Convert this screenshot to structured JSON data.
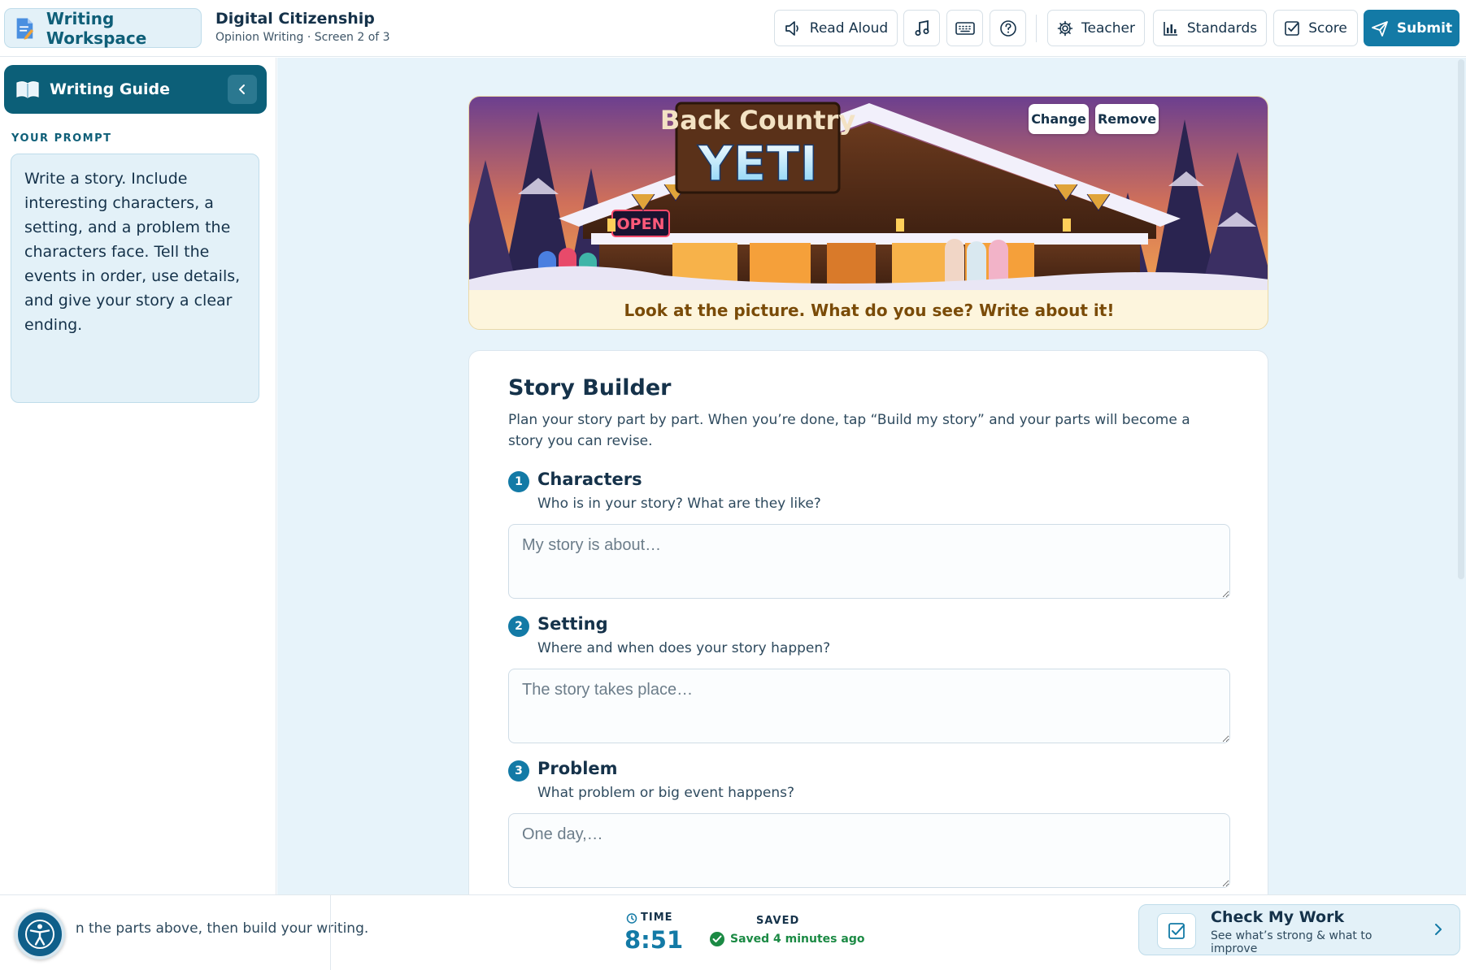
{
  "topbar": {
    "app_name": "Writing Workspace",
    "doc_title": "Digital Citizenship",
    "doc_subtitle": "Opinion Writing · Screen 2 of 3",
    "read_aloud_label": "Read Aloud",
    "teacher_label": "Teacher",
    "standards_label": "Standards",
    "score_label": "Score",
    "submit_label": "Submit"
  },
  "sidebar": {
    "guide_title": "Writing Guide",
    "prompt_label": "YOUR PROMPT",
    "prompt_text": "Write a story. Include interesting characters, a setting, and a problem the characters face. Tell the events in order, use details, and give your story a clear ending."
  },
  "banner": {
    "sign_line1": "Back Country",
    "sign_line2": "YETI",
    "open_sign": "OPEN",
    "change_label": "Change",
    "remove_label": "Remove",
    "caption": "Look at the picture. What do you see? Write about it!"
  },
  "builder": {
    "title": "Story Builder",
    "description": "Plan your story part by part. When you’re done, tap “Build my story” and your parts will become a story you can revise.",
    "steps": [
      {
        "number": "1",
        "title": "Characters",
        "hint": "Who is in your story? What are they like?",
        "placeholder": "My story is about…",
        "value": ""
      },
      {
        "number": "2",
        "title": "Setting",
        "hint": "Where and when does your story happen?",
        "placeholder": "The story takes place…",
        "value": ""
      },
      {
        "number": "3",
        "title": "Problem",
        "hint": "What problem or big event happens?",
        "placeholder": "One day,…",
        "value": ""
      }
    ]
  },
  "bottombar": {
    "hint": "Fill in the parts above, then build your writing.",
    "time_label": "TIME",
    "time_value": "8:51",
    "saved_label": "SAVED",
    "saved_value": "Saved 4 minutes ago",
    "check_title": "Check My Work",
    "check_subtitle": "See what’s strong & what to improve"
  },
  "colors": {
    "primary": "#137aa6",
    "guide_header": "#0c5f78",
    "main_bg": "#e7f3fa",
    "caption_bg": "#fdf5dd",
    "caption_text": "#7a4b08",
    "saved_green": "#1b8a44"
  },
  "icons": {
    "brand": "document-pencil-icon",
    "read_aloud": "speaker-icon",
    "music": "music-note-icon",
    "keyboard": "keyboard-icon",
    "help": "question-circle-icon",
    "teacher": "gear-icon",
    "standards": "bar-chart-icon",
    "score": "checkbox-icon",
    "submit": "paper-plane-icon",
    "guide": "open-book-icon",
    "collapse": "chevron-left-icon",
    "accessibility": "accessibility-person-icon",
    "timer": "stopwatch-icon",
    "saved": "check-circle-icon",
    "check_work": "checkbox-icon",
    "check_arrow": "chevron-right-icon"
  }
}
